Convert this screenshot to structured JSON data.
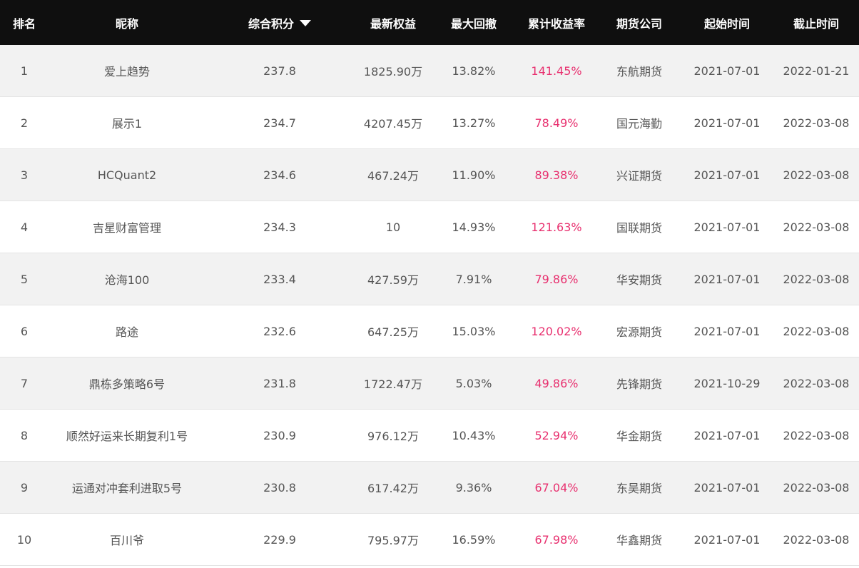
{
  "table": {
    "headers": {
      "rank": "排名",
      "nickname": "昵称",
      "score": "综合积分",
      "equity": "最新权益",
      "drawdown": "最大回撤",
      "return": "累计收益率",
      "company": "期货公司",
      "start": "起始时间",
      "end": "截止时间"
    },
    "sort": {
      "column": "score",
      "direction": "desc",
      "icon": "sort-desc-triangle-icon"
    },
    "colors": {
      "header_bg": "#0f0f0f",
      "header_text": "#ffffff",
      "row_odd_bg": "#f2f2f2",
      "row_even_bg": "#ffffff",
      "text": "#555555",
      "return_text": "#e8306f"
    },
    "rows": [
      {
        "rank": "1",
        "nickname": "爱上趋势",
        "score": "237.8",
        "equity": "1825.90万",
        "drawdown": "13.82%",
        "return": "141.45%",
        "company": "东航期货",
        "start": "2021-07-01",
        "end": "2022-01-21"
      },
      {
        "rank": "2",
        "nickname": "展示1",
        "score": "234.7",
        "equity": "4207.45万",
        "drawdown": "13.27%",
        "return": "78.49%",
        "company": "国元海勤",
        "start": "2021-07-01",
        "end": "2022-03-08"
      },
      {
        "rank": "3",
        "nickname": "HCQuant2",
        "score": "234.6",
        "equity": "467.24万",
        "drawdown": "11.90%",
        "return": "89.38%",
        "company": "兴证期货",
        "start": "2021-07-01",
        "end": "2022-03-08"
      },
      {
        "rank": "4",
        "nickname": "吉星财富管理",
        "score": "234.3",
        "equity": "10",
        "drawdown": "14.93%",
        "return": "121.63%",
        "company": "国联期货",
        "start": "2021-07-01",
        "end": "2022-03-08"
      },
      {
        "rank": "5",
        "nickname": "沧海100",
        "score": "233.4",
        "equity": "427.59万",
        "drawdown": "7.91%",
        "return": "79.86%",
        "company": "华安期货",
        "start": "2021-07-01",
        "end": "2022-03-08"
      },
      {
        "rank": "6",
        "nickname": "路途",
        "score": "232.6",
        "equity": "647.25万",
        "drawdown": "15.03%",
        "return": "120.02%",
        "company": "宏源期货",
        "start": "2021-07-01",
        "end": "2022-03-08"
      },
      {
        "rank": "7",
        "nickname": "鼎栋多策略6号",
        "score": "231.8",
        "equity": "1722.47万",
        "drawdown": "5.03%",
        "return": "49.86%",
        "company": "先锋期货",
        "start": "2021-10-29",
        "end": "2022-03-08"
      },
      {
        "rank": "8",
        "nickname": "顺然好运来长期复利1号",
        "score": "230.9",
        "equity": "976.12万",
        "drawdown": "10.43%",
        "return": "52.94%",
        "company": "华金期货",
        "start": "2021-07-01",
        "end": "2022-03-08"
      },
      {
        "rank": "9",
        "nickname": "运通对冲套利进取5号",
        "score": "230.8",
        "equity": "617.42万",
        "drawdown": "9.36%",
        "return": "67.04%",
        "company": "东吴期货",
        "start": "2021-07-01",
        "end": "2022-03-08"
      },
      {
        "rank": "10",
        "nickname": "百川爷",
        "score": "229.9",
        "equity": "795.97万",
        "drawdown": "16.59%",
        "return": "67.98%",
        "company": "华鑫期货",
        "start": "2021-07-01",
        "end": "2022-03-08"
      }
    ]
  }
}
